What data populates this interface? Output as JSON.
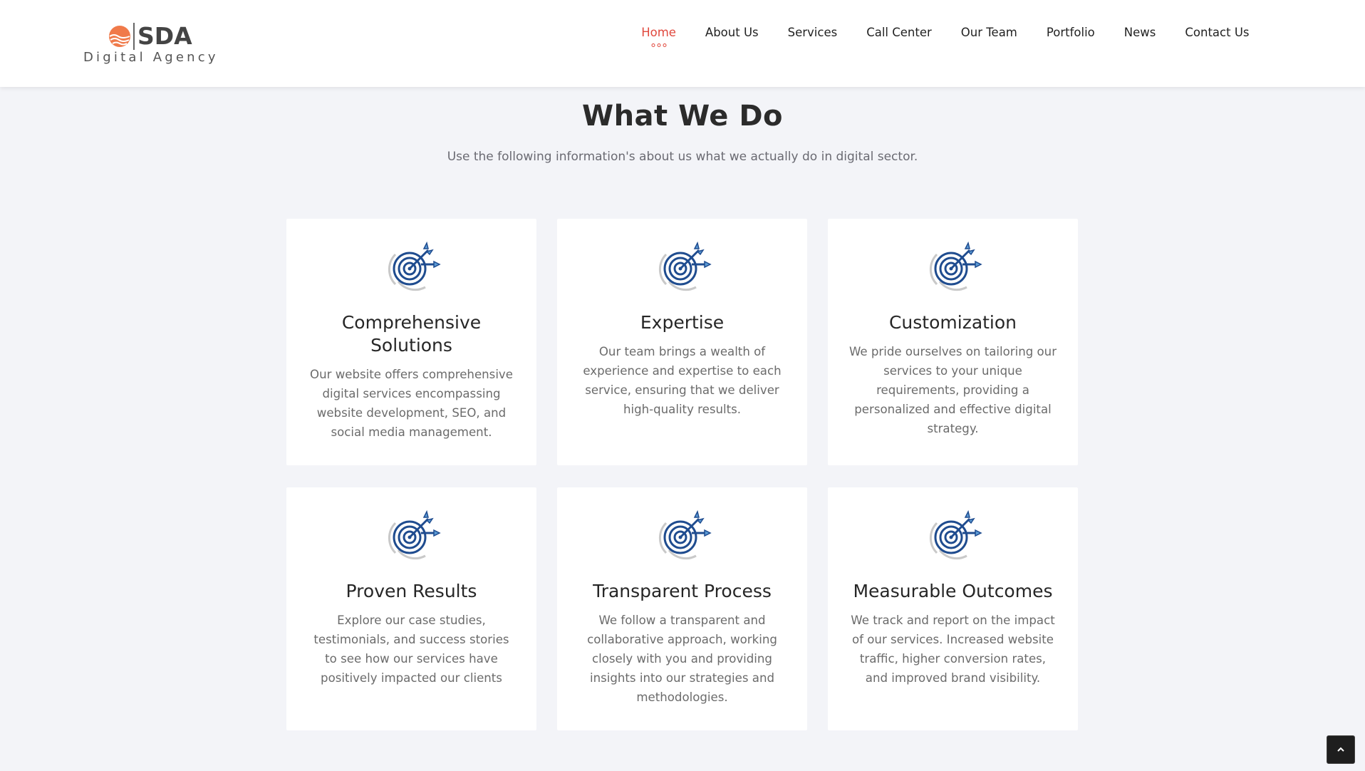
{
  "brand": {
    "name": "SDA",
    "tagline": "Digital Agency",
    "accent": "#e0483d",
    "logo_color": "#f07a4a"
  },
  "nav": {
    "items": [
      {
        "label": "Home",
        "active": true
      },
      {
        "label": "About Us"
      },
      {
        "label": "Services"
      },
      {
        "label": "Call Center"
      },
      {
        "label": "Our Team"
      },
      {
        "label": "Portfolio"
      },
      {
        "label": "News"
      },
      {
        "label": "Contact Us"
      }
    ]
  },
  "section": {
    "title": "What We Do",
    "subtitle": "Use the following information's about us what we actually do in digital sector."
  },
  "cards": [
    {
      "icon": "target-arrow-icon",
      "title": "Comprehensive Solutions",
      "desc": "Our website offers comprehensive digital services encompassing website development, SEO, and social media management."
    },
    {
      "icon": "target-arrow-icon",
      "title": "Expertise",
      "desc": "Our team brings a wealth of experience and expertise to each service, ensuring that we deliver high-quality results."
    },
    {
      "icon": "target-arrow-icon",
      "title": "Customization",
      "desc": "We pride ourselves on tailoring our services to your unique requirements, providing a personalized and effective digital strategy."
    },
    {
      "icon": "target-arrow-icon",
      "title": "Proven Results",
      "desc": "Explore our case studies, testimonials, and success stories to see how our services have positively impacted our clients"
    },
    {
      "icon": "target-arrow-icon",
      "title": "Transparent Process",
      "desc": "We follow a transparent and collaborative approach, working closely with you and providing insights into our strategies and methodologies."
    },
    {
      "icon": "target-arrow-icon",
      "title": "Measurable Outcomes",
      "desc": "We track and report on the impact of our services. Increased website traffic, higher conversion rates, and improved brand visibility."
    }
  ],
  "scroll_top": {
    "icon": "chevron-up-icon"
  }
}
